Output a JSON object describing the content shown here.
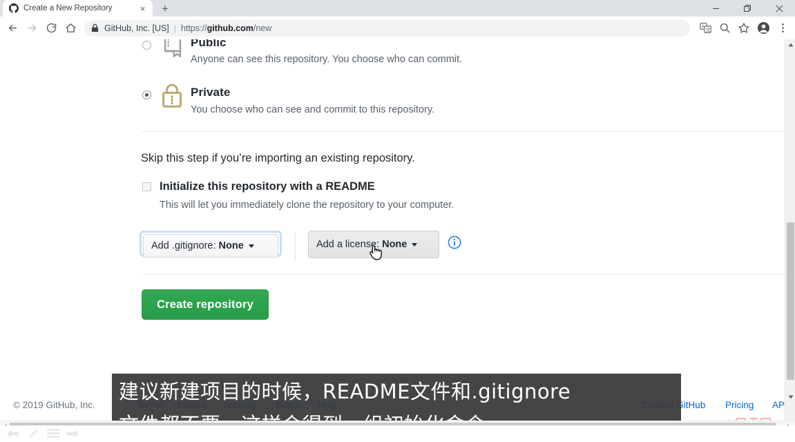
{
  "browser": {
    "tab": {
      "title": "Create a New Repository",
      "favicon": "github-icon",
      "close_label": "×"
    },
    "new_tab_label": "+",
    "window_controls": {
      "minimize": "—",
      "restore": "❐",
      "close": "✕"
    },
    "nav": {
      "back": "back-icon",
      "forward": "forward-icon",
      "reload": "reload-icon",
      "home": "home-icon"
    },
    "omnibox": {
      "lock": "lock-icon",
      "org": "GitHub, Inc. [US]",
      "separator": "|",
      "url_scheme": "https://",
      "url_host": "github.com",
      "url_path": "/new"
    },
    "toolbar_icons": [
      "translate-icon",
      "zoom-icon",
      "bookmark-star-icon",
      "profile-avatar-icon",
      "overflow-menu-icon"
    ]
  },
  "page": {
    "visibility": {
      "public": {
        "title": "Public",
        "description": "Anyone can see this repository. You choose who can commit.",
        "selected": false,
        "icon": "repo-book-icon"
      },
      "private": {
        "title": "Private",
        "description": "You choose who can see and commit to this repository.",
        "selected": true,
        "icon": "lock-icon",
        "icon_color": "#b9a66b"
      }
    },
    "skip_text": "Skip this step if you’re importing an existing repository.",
    "readme": {
      "label": "Initialize this repository with a README",
      "description": "This will let you immediately clone the repository to your computer.",
      "checked": false
    },
    "gitignore_button": {
      "label": "Add .gitignore:",
      "value": "None",
      "focused": true
    },
    "license_button": {
      "label": "Add a license:",
      "value": "None",
      "hovered": true
    },
    "info_icon": "info-circle-icon",
    "create_button": {
      "label": "Create repository",
      "color": "#2ea44f"
    },
    "footer": {
      "copyright": "© 2019 GitHub, Inc.",
      "left_links": [
        "Terms",
        "Privacy",
        "Security",
        "Status",
        "Help"
      ],
      "right_links": [
        "Contact GitHub",
        "Pricing",
        "API"
      ]
    }
  },
  "overlay": {
    "subtitle_line1": "建议新建项目的时候，README文件和.gitignore",
    "subtitle_line2": "文件都不要，这样会得到一组初始化命令",
    "watermark": "CSDN @"
  },
  "scrollbars": {
    "vertical_up": "▲",
    "vertical_down": "▼",
    "horizontal_left": "◀",
    "horizontal_right": "▶"
  }
}
